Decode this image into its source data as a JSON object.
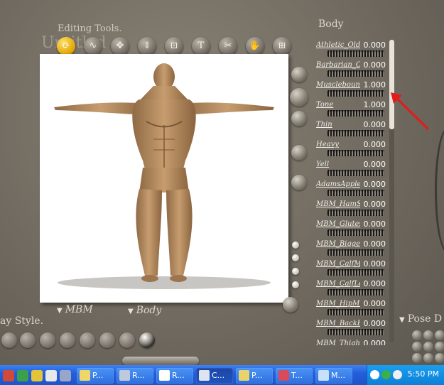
{
  "window": {
    "editing_tools_label": "Editing Tools.",
    "untitled_label": "Untitled"
  },
  "toolbar": {
    "tools": [
      {
        "icon": "rotate-icon",
        "glyph": "⟳",
        "active": true
      },
      {
        "icon": "twist-icon",
        "glyph": "∿"
      },
      {
        "icon": "translate-icon",
        "glyph": "✥"
      },
      {
        "icon": "scale-icon",
        "glyph": "⇕"
      },
      {
        "icon": "taper-icon",
        "glyph": "⊡"
      },
      {
        "icon": "chain-break-icon",
        "glyph": "T"
      },
      {
        "icon": "color-icon",
        "glyph": "✂"
      },
      {
        "icon": "grouping-icon",
        "glyph": "✋"
      },
      {
        "icon": "view-magnifier-icon",
        "glyph": "⊞"
      }
    ]
  },
  "preview": {
    "subject": "3D muscular male figure in T-pose",
    "figure_dropdown": "MBM",
    "part_dropdown": "Body"
  },
  "display_style": {
    "label": "ay Style."
  },
  "body_panel": {
    "title": "Body",
    "parameters": [
      {
        "label": "Athletic_Old",
        "value": "0.000"
      },
      {
        "label": "Barbarian_Old",
        "value": "0.000"
      },
      {
        "label": "Musclebound",
        "value": "1.000"
      },
      {
        "label": "Tone",
        "value": "1.000"
      },
      {
        "label": "Thin",
        "value": "0.000"
      },
      {
        "label": "Heavy",
        "value": "0.000"
      },
      {
        "label": "Yell",
        "value": "0.000"
      },
      {
        "label": "AdamsApple",
        "value": "0.000"
      },
      {
        "label": "MBM_HamStr",
        "value": "0.000"
      },
      {
        "label": "MBM_Glutes",
        "value": "0.000"
      },
      {
        "label": "MBM_Bigger",
        "value": "0.000"
      },
      {
        "label": "MBM_CalfMu",
        "value": "0.000"
      },
      {
        "label": "MBM_CalfLe",
        "value": "0.000"
      },
      {
        "label": "MBM_HipMu",
        "value": "0.000"
      },
      {
        "label": "MBM_BackBu",
        "value": "0.000"
      },
      {
        "label": "MBM_Thighs",
        "value": "0.000"
      }
    ]
  },
  "pose": {
    "label": "Pose D"
  },
  "taskbar": {
    "buttons": [
      {
        "label": "P...",
        "active": false
      },
      {
        "label": "R...",
        "active": false
      },
      {
        "label": "R...",
        "active": false
      },
      {
        "label": "C...",
        "active": true
      },
      {
        "label": "P...",
        "active": false
      },
      {
        "label": "T...",
        "active": false
      },
      {
        "label": "M...",
        "active": false
      }
    ],
    "clock": "5:50 PM"
  },
  "colors": {
    "annotation_arrow": "#e31b1b",
    "taskbar_blue": "#245edb",
    "tray_blue": "#0d7fd6"
  }
}
